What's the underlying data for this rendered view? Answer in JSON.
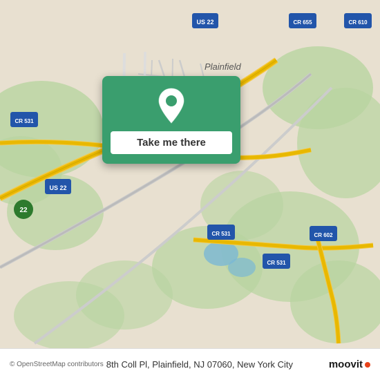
{
  "map": {
    "alt": "Map of Plainfield NJ area"
  },
  "popup": {
    "button_label": "Take me there",
    "background_color": "#3a9e6e"
  },
  "bottom_bar": {
    "address": "8th Coll Pl, Plainfield, NJ 07060, New York City",
    "copyright": "© OpenStreetMap contributors",
    "logo_text": "moovit"
  }
}
